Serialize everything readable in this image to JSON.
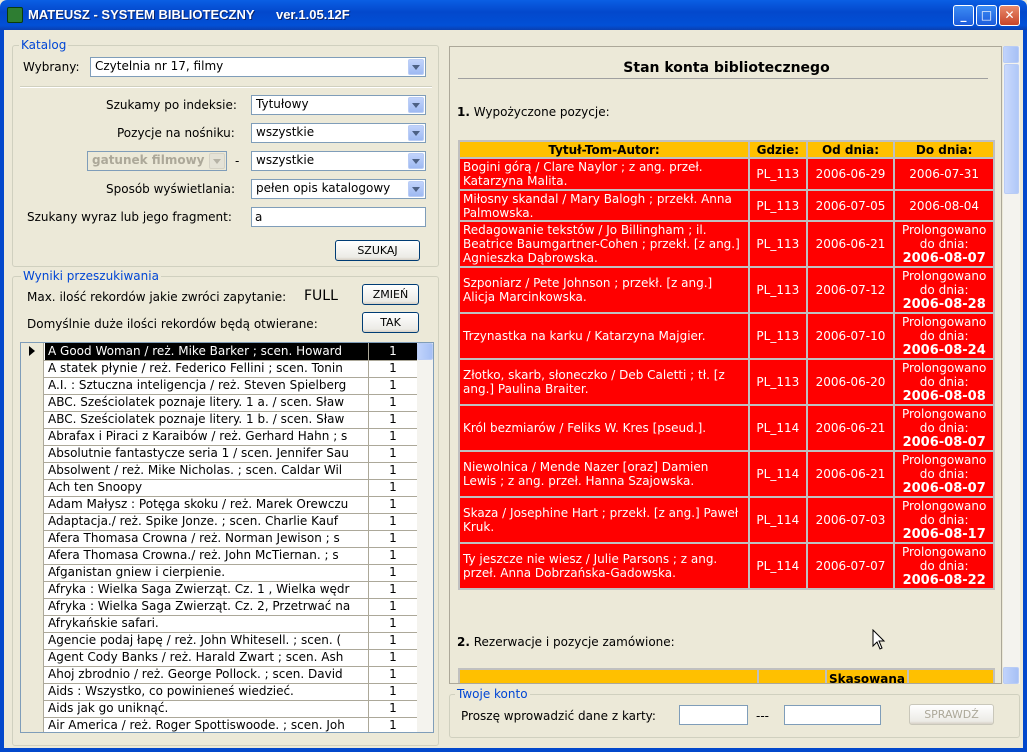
{
  "window": {
    "title": "MATEUSZ - SYSTEM BIBLIOTECZNY      ver.1.05.12F"
  },
  "katalog": {
    "legend": "Katalog",
    "wybrany_label": "Wybrany:",
    "wybrany_value": "Czytelnia nr 17, filmy",
    "index_label": "Szukamy po indeksie:",
    "index_value": "Tytułowy",
    "nosnik_label": "Pozycje na nośniku:",
    "nosnik_value": "wszystkie",
    "gatunek_value": "gatunek filmowy",
    "dash": "-",
    "gatunek2_value": "wszystkie",
    "sposob_label": "Sposób wyświetlania:",
    "sposob_value": "pełen opis katalogowy",
    "szukany_label": "Szukany wyraz lub jego fragment:",
    "szukany_value": "a",
    "szukaj_button": "SZUKAJ"
  },
  "wyniki": {
    "legend": "Wyniki przeszukiwania",
    "max_label": "Max. ilość rekordów jakie zwróci zapytanie:",
    "max_value": "FULL",
    "zmien_button": "ZMIEŃ",
    "domyslnie_label": "Domyślnie duże ilości rekordów będą otwierane:",
    "tak_button": "TAK",
    "rows": [
      {
        "title": "A Good Woman /    reż. Mike Barker ; scen. Howard",
        "count": "1"
      },
      {
        "title": "A statek płynie /    reż. Federico Fellini ; scen. Tonin",
        "count": "1"
      },
      {
        "title": "A.I. : Sztuczna inteligencja /   reż. Steven Spielberg",
        "count": "1"
      },
      {
        "title": "ABC. Sześciolatek poznaje litery.  1 a. /  scen. Sław",
        "count": "1"
      },
      {
        "title": "ABC. Sześciolatek poznaje litery.  1 b. /  scen. Sław",
        "count": "1"
      },
      {
        "title": "Abrafax i Piraci z Karaibów /    reż. Gerhard Hahn ; s",
        "count": "1"
      },
      {
        "title": "Absolutnie fantastycze  seria 1 /  scen. Jennifer Sau",
        "count": "1"
      },
      {
        "title": "Absolwent /    reż. Mike Nicholas. ; scen. Caldar Wil",
        "count": "1"
      },
      {
        "title": "Ach ten Snoopy",
        "count": "1"
      },
      {
        "title": "Adam Małysz : Potęga skoku /    reż. Marek Orewczu",
        "count": "1"
      },
      {
        "title": "Adaptacja./    reż. Spike Jonze. ; scen. Charlie Kauf",
        "count": "1"
      },
      {
        "title": "Afera Thomasa Crowna /    reż. Norman Jewison ; s",
        "count": "1"
      },
      {
        "title": "Afera Thomasa Crowna./    reż. John McTiernan. ; s",
        "count": "1"
      },
      {
        "title": "Afganistan gniew i cierpienie.",
        "count": "1"
      },
      {
        "title": "Afryka : Wielka Saga Zwierząt. Cz. 1 , Wielka wędr",
        "count": "1"
      },
      {
        "title": "Afryka : Wielka Saga Zwierząt. Cz. 2, Przetrwać na",
        "count": "1"
      },
      {
        "title": "Afrykańskie safari.",
        "count": "1"
      },
      {
        "title": "Agencie podaj łapę /    reż. John Whitesell. ; scen. (",
        "count": "1"
      },
      {
        "title": "Agent Cody Banks /    reż. Harald Zwart ; scen. Ash",
        "count": "1"
      },
      {
        "title": "Ahoj zbrodnio /    reż. George Pollock. ; scen. David",
        "count": "1"
      },
      {
        "title": "Aids : Wszystko, co powinieneś wiedzieć.",
        "count": "1"
      },
      {
        "title": "Aids jak go uniknąć.",
        "count": "1"
      },
      {
        "title": "Air America /    reż. Roger Spottiswoode. ; scen. Joh",
        "count": "1"
      }
    ]
  },
  "stan": {
    "heading": "Stan konta bibliotecznego",
    "section1_num": "1.",
    "section1_label": "Wypożyczone pozycje:",
    "headers": [
      "Tytuł-Tom-Autor:",
      "Gdzie:",
      "Od dnia:",
      "Do dnia:"
    ],
    "prolong_label": "Prolongowano do dnia:",
    "loans": [
      {
        "title": "Bogini górą / Clare Naylor ; z ang. przeł. Katarzyna Malita.",
        "where": "PL_113",
        "from": "2006-06-29",
        "to": "2006-07-31",
        "prolonged": false
      },
      {
        "title": "Miłosny skandal / Mary Balogh ; przekł. Anna Palmowska.",
        "where": "PL_113",
        "from": "2006-07-05",
        "to": "2006-08-04",
        "prolonged": false
      },
      {
        "title": "Redagowanie tekstów / Jo Billingham ; il. Beatrice Baumgartner-Cohen ; przekł. [z ang.] Agnieszka Dąbrowska.",
        "where": "PL_113",
        "from": "2006-06-21",
        "to": "2006-08-07",
        "prolonged": true
      },
      {
        "title": "Szponiarz / Pete Johnson ; przekł. [z ang.] Alicja Marcinkowska.",
        "where": "PL_113",
        "from": "2006-07-12",
        "to": "2006-08-28",
        "prolonged": true
      },
      {
        "title": "Trzynastka na karku / Katarzyna Majgier.",
        "where": "PL_113",
        "from": "2006-07-10",
        "to": "2006-08-24",
        "prolonged": true
      },
      {
        "title": "Złotko, skarb, słoneczko / Deb Caletti ; tł. [z ang.] Paulina Braiter.",
        "where": "PL_113",
        "from": "2006-06-20",
        "to": "2006-08-08",
        "prolonged": true
      },
      {
        "title": "Król bezmiarów / Feliks W. Kres [pseud.].",
        "where": "PL_114",
        "from": "2006-06-21",
        "to": "2006-08-07",
        "prolonged": true
      },
      {
        "title": "Niewolnica / Mende Nazer [oraz] Damien Lewis ; z ang. przeł. Hanna Szajowska.",
        "where": "PL_114",
        "from": "2006-06-21",
        "to": "2006-08-07",
        "prolonged": true
      },
      {
        "title": "Skaza / Josephine Hart ; przekł. [z ang.] Paweł Kruk.",
        "where": "PL_114",
        "from": "2006-07-03",
        "to": "2006-08-17",
        "prolonged": true
      },
      {
        "title": "Ty jeszcze nie wiesz / Julie Parsons ; z ang. przeł. Anna Dobrzańska-Gadowska.",
        "where": "PL_114",
        "from": "2006-07-07",
        "to": "2006-08-22",
        "prolonged": true
      }
    ],
    "section2_num": "2.",
    "section2_label": "Rezerwacje i pozycje zamówione:",
    "res_header_partial": "Skasowana"
  },
  "konto": {
    "legend": "Twoje konto",
    "label": "Proszę wprowadzić dane z karty:",
    "field1": "",
    "dash": "---",
    "field2": "",
    "sprawdz_button": "SPRAWDŹ"
  },
  "colors": {
    "title_bar": "#0348CC",
    "accent": "#0046D5",
    "loan_row": "#FF0000",
    "table_header": "#FFC000"
  }
}
